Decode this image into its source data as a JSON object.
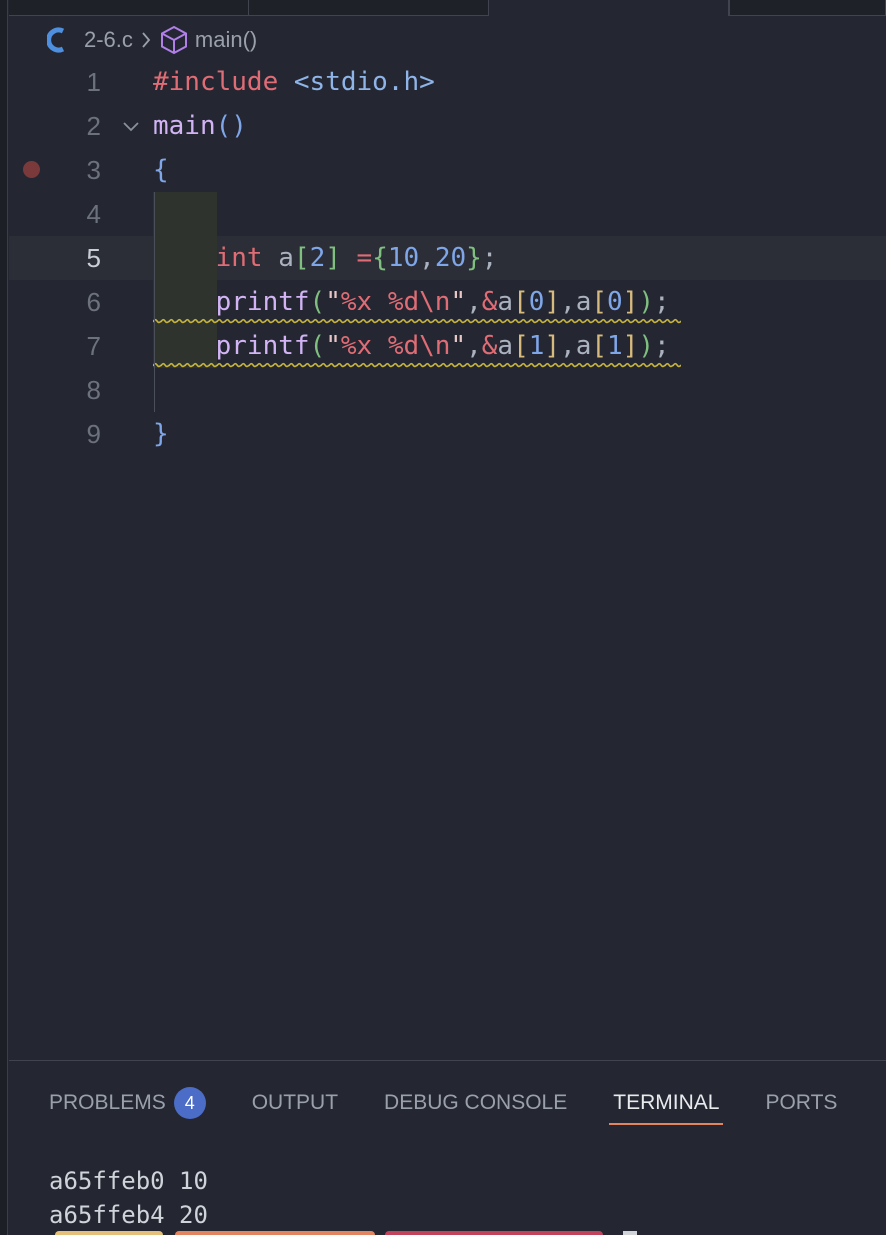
{
  "breadcrumb": {
    "file": "2-6.c",
    "symbol": "main()"
  },
  "editor": {
    "lines": [
      {
        "num": "1"
      },
      {
        "num": "2"
      },
      {
        "num": "3"
      },
      {
        "num": "4"
      },
      {
        "num": "5"
      },
      {
        "num": "6"
      },
      {
        "num": "7"
      },
      {
        "num": "8"
      },
      {
        "num": "9"
      }
    ],
    "current_line": "5",
    "breakpoint_line": "3"
  },
  "panel": {
    "tabs": [
      {
        "label": "PROBLEMS",
        "badge": "4"
      },
      {
        "label": "OUTPUT"
      },
      {
        "label": "DEBUG CONSOLE"
      },
      {
        "label": "TERMINAL",
        "active": true
      },
      {
        "label": "PORTS"
      }
    ],
    "terminal_output": [
      "a65ffeb0 10",
      "a65ffeb4 20"
    ]
  },
  "colors": {
    "background": "#242731",
    "accent_tab": "#e2845f",
    "badge": "#4b6cc7",
    "breakpoint": "#7a3a3b",
    "warning_squiggle": "#c6b33a"
  }
}
